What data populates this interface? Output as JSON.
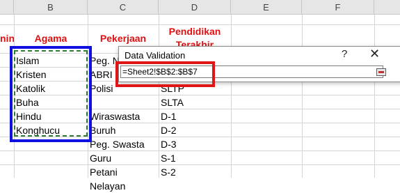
{
  "columns": [
    "B",
    "C",
    "D",
    "E",
    "F"
  ],
  "headers": {
    "col_a_partial": "nin",
    "agama": "Agama",
    "pekerjaan": "Pekerjaan",
    "pendidikan_line1": "Pendidikan",
    "pendidikan_line2": "Terakhir"
  },
  "agama_list": [
    "Islam",
    "Kristen",
    "Katolik",
    "Buha",
    "Hindu",
    "Konghucu"
  ],
  "pekerjaan_list": [
    "Peg. N",
    "ABRI",
    "Polisi",
    "Wiraswasta",
    "Buruh",
    "Peg. Swasta",
    "Guru",
    "Petani",
    "Nelayan"
  ],
  "pendidikan_list": [
    "",
    "",
    "SLTP",
    "SLTA",
    "D-1",
    "D-2",
    "D-3",
    "S-1",
    "S-2"
  ],
  "dialog": {
    "title": "Data Validation",
    "help": "?",
    "close": "✕",
    "formula": "=Sheet2!$B$2:$B$7"
  },
  "colors": {
    "header_text": "#e01010",
    "highlight_blue": "#1010e0",
    "highlight_red": "#e01515",
    "marquee_green": "#2e7d32"
  }
}
